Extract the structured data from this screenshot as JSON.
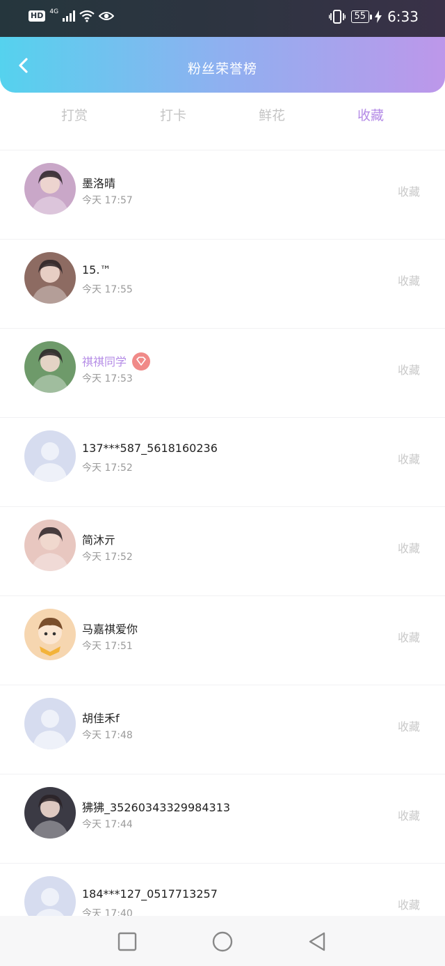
{
  "status_bar": {
    "left_badge": "HD",
    "network": "4G",
    "battery": "55",
    "time": "6:33"
  },
  "header": {
    "title": "粉丝荣誉榜"
  },
  "tabs": [
    {
      "label": "打赏"
    },
    {
      "label": "打卡"
    },
    {
      "label": "鲜花"
    },
    {
      "label": "收藏"
    }
  ],
  "active_tab": "收藏",
  "list": [
    {
      "name": "墨洛晴",
      "time": "今天 17:57",
      "action": "收藏",
      "avatar": "photo",
      "color": "#c9a7c8"
    },
    {
      "name": "15.™",
      "time": "今天 17:55",
      "action": "收藏",
      "avatar": "photo",
      "color": "#8d6b62"
    },
    {
      "name": "祺祺同学",
      "time": "今天 17:53",
      "action": "收藏",
      "avatar": "photo",
      "color": "#6e9a6a",
      "vip": true
    },
    {
      "name": "137***587_5618160236",
      "time": "今天 17:52",
      "action": "收藏",
      "avatar": "default",
      "color": "#d4dbee"
    },
    {
      "name": "简沐亓",
      "time": "今天 17:52",
      "action": "收藏",
      "avatar": "photo",
      "color": "#e8c7c0"
    },
    {
      "name": "马嘉祺爱你",
      "time": "今天 17:51",
      "action": "收藏",
      "avatar": "cartoon",
      "color": "#f6d6b0"
    },
    {
      "name": "胡佳禾f",
      "time": "今天 17:48",
      "action": "收藏",
      "avatar": "default",
      "color": "#d4dbee"
    },
    {
      "name": "狒狒_35260343329984313",
      "time": "今天 17:44",
      "action": "收藏",
      "avatar": "photo",
      "color": "#3b3a44"
    },
    {
      "name": "184***127_0517713257",
      "time": "今天 17:40",
      "action": "收藏",
      "avatar": "default",
      "color": "#d4dbee"
    }
  ],
  "colors": {
    "accent": "#b48be6",
    "header_start": "#55d2ee",
    "header_end": "#bd97ea",
    "muted": "#c4c4c4"
  },
  "nav": {
    "icons": [
      "square-icon",
      "circle-icon",
      "triangle-back-icon"
    ]
  }
}
